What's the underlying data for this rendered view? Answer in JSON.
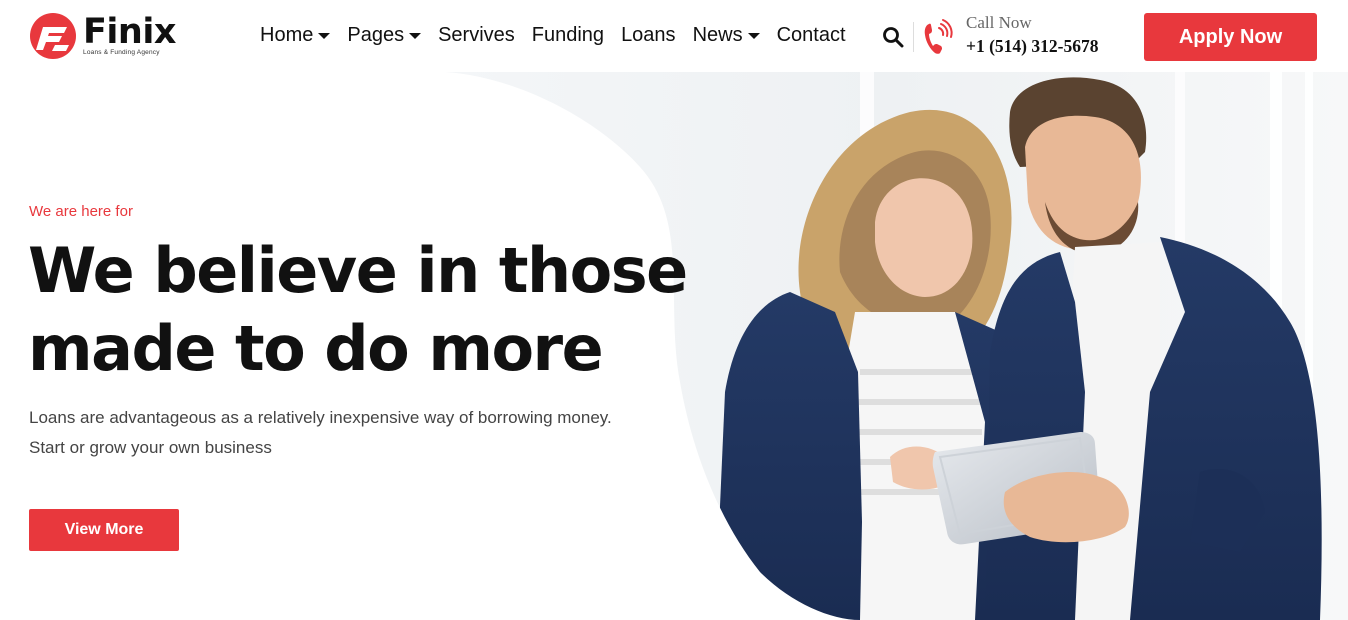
{
  "brand": {
    "name": "Finix",
    "tagline": "Loans & Funding Agency",
    "accent_color": "#e8383d",
    "logo_icon": "finix-logo-icon"
  },
  "nav": {
    "items": [
      {
        "label": "Home",
        "has_dropdown": true
      },
      {
        "label": "Pages",
        "has_dropdown": true
      },
      {
        "label": "Servives",
        "has_dropdown": false
      },
      {
        "label": "Funding",
        "has_dropdown": false
      },
      {
        "label": "Loans",
        "has_dropdown": false
      },
      {
        "label": "News",
        "has_dropdown": true
      },
      {
        "label": "Contact",
        "has_dropdown": false
      }
    ],
    "search_icon": "search-icon"
  },
  "contact": {
    "icon": "phone-icon",
    "label": "Call Now",
    "number": "+1 (514) 312-5678"
  },
  "header": {
    "apply_label": "Apply Now"
  },
  "hero": {
    "eyebrow": "We are here for",
    "headline_line1": "We believe in those",
    "headline_line2": "made to do more",
    "description_line1": "Loans are advantageous as a relatively inexpensive way of borrowing money.",
    "description_line2": "Start or grow your own business",
    "cta_label": "View More",
    "image_subject": "business-people-with-tablet-photo"
  }
}
